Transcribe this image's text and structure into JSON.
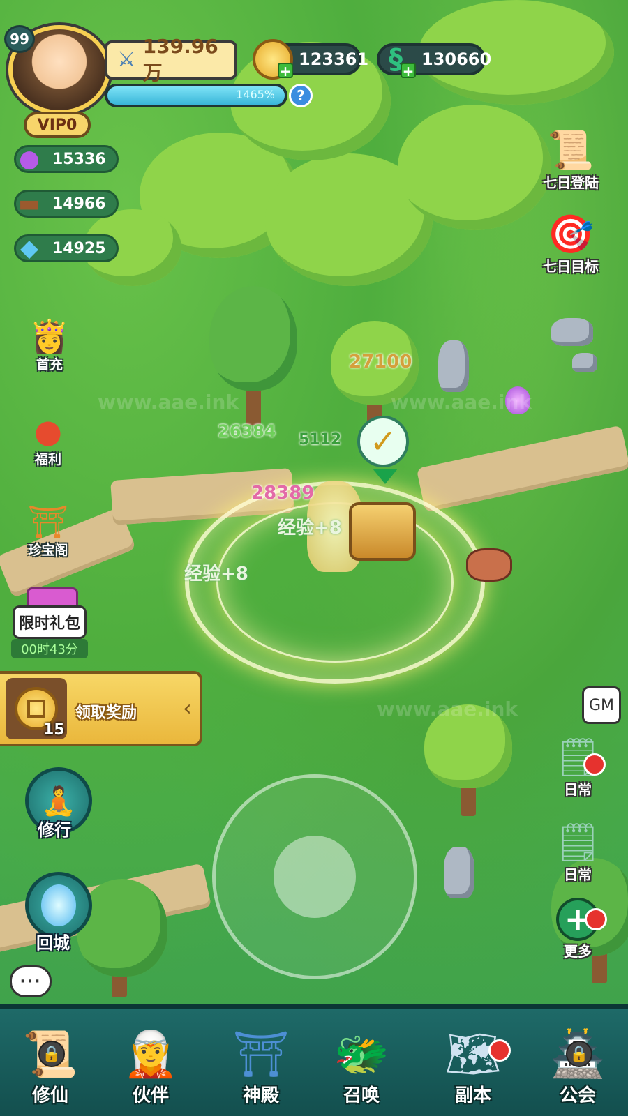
{
  "player": {
    "level": "99",
    "vip": "VIP0",
    "power": "139.96万",
    "exp_percent": "1465%"
  },
  "currencies": [
    {
      "name": "coin",
      "icon": "coin-icon",
      "value": "123361"
    },
    {
      "name": "jade",
      "icon": "jade-dragon-icon",
      "value": "130660"
    }
  ],
  "resources": [
    {
      "icon": "purple-flame-icon",
      "value": "15336"
    },
    {
      "icon": "wood-log-icon",
      "value": "14966"
    },
    {
      "icon": "crystal-icon",
      "value": "14925"
    }
  ],
  "left_menu": {
    "first_charge": "首充",
    "welfare": "福利",
    "treasure_pavilion": "珍宝阁",
    "limited_gift": "限时礼包",
    "gift_timer": "00时43分",
    "reward_text": "领取奖励",
    "reward_count": "15",
    "cultivate": "修行",
    "return_city": "回城"
  },
  "right_menu": {
    "seven_day_login": "七日登陆",
    "seven_day_goal": "七日目标",
    "gm": "GM",
    "daily_1": "日常",
    "daily_2": "日常",
    "more": "更多"
  },
  "battle_text": {
    "damage_1": "27100",
    "damage_2": "26384",
    "damage_3": "28389",
    "exp_gain": "经验+8",
    "exp_gain_2": "经验+8",
    "hp_small": "5112"
  },
  "bottom_nav": [
    {
      "label": "修仙",
      "icon": "scroll-icon",
      "locked": true
    },
    {
      "label": "伙伴",
      "icon": "partner-icon",
      "locked": false
    },
    {
      "label": "神殿",
      "icon": "temple-icon",
      "locked": false
    },
    {
      "label": "召唤",
      "icon": "summon-icon",
      "locked": false
    },
    {
      "label": "副本",
      "icon": "dungeon-icon",
      "locked": false
    },
    {
      "label": "公会",
      "icon": "guild-icon",
      "locked": true
    }
  ],
  "chat_label": "···",
  "watermark": "www.aae.ink",
  "colors": {
    "grass": "#3fa64a",
    "path": "#d9c08f",
    "bottom_bar": "#1e6a68",
    "gold": "#f7d766",
    "notify_red": "#e6322e"
  }
}
